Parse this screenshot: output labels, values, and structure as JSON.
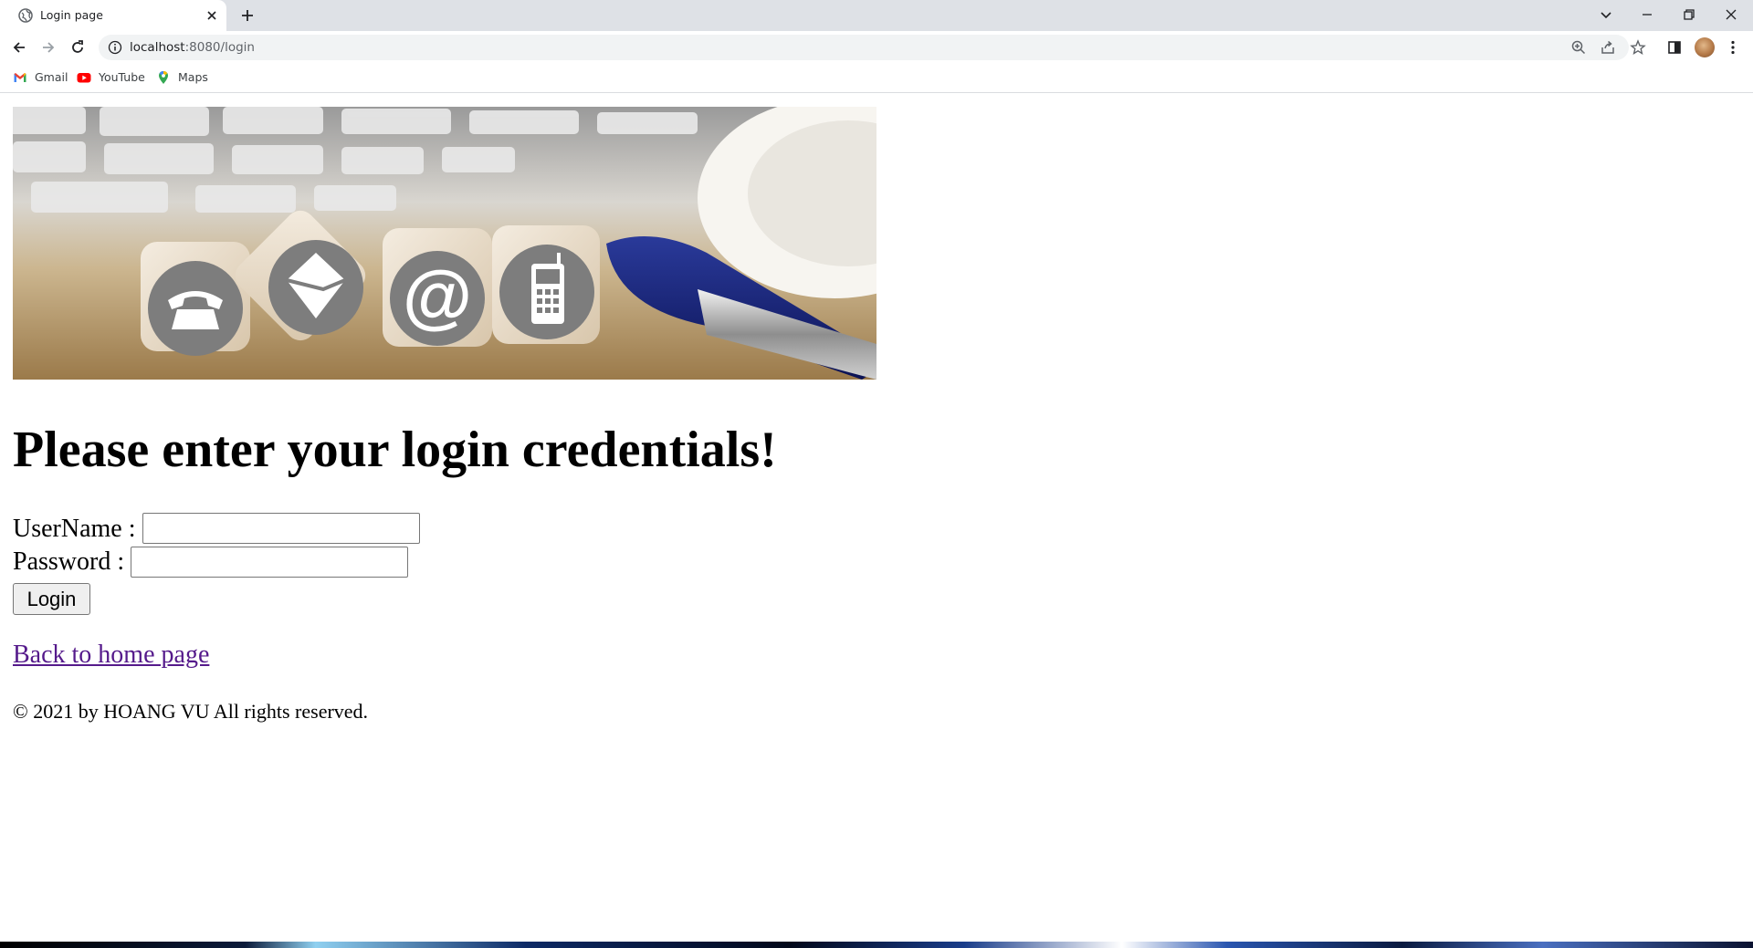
{
  "browser": {
    "tab_title": "Login page",
    "url_host": "localhost",
    "url_rest": ":8080/login",
    "bookmarks": [
      {
        "label": "Gmail",
        "icon": "gmail-icon"
      },
      {
        "label": "YouTube",
        "icon": "youtube-icon"
      },
      {
        "label": "Maps",
        "icon": "maps-icon"
      }
    ]
  },
  "page": {
    "title": "Please enter your login credentials!",
    "username_label": "UserName :",
    "username_value": "",
    "password_label": "Password :",
    "password_value": "",
    "login_button": "Login",
    "home_link": "Back to home page",
    "footer": "© 2021 by HOANG VU All rights reserved.",
    "banner_icons": [
      "telephone-icon",
      "envelope-icon",
      "at-sign-icon",
      "mobile-phone-icon"
    ]
  },
  "colors": {
    "link_visited": "#551a8b",
    "tabstrip": "#dee1e6",
    "omnibox": "#f1f3f4"
  }
}
